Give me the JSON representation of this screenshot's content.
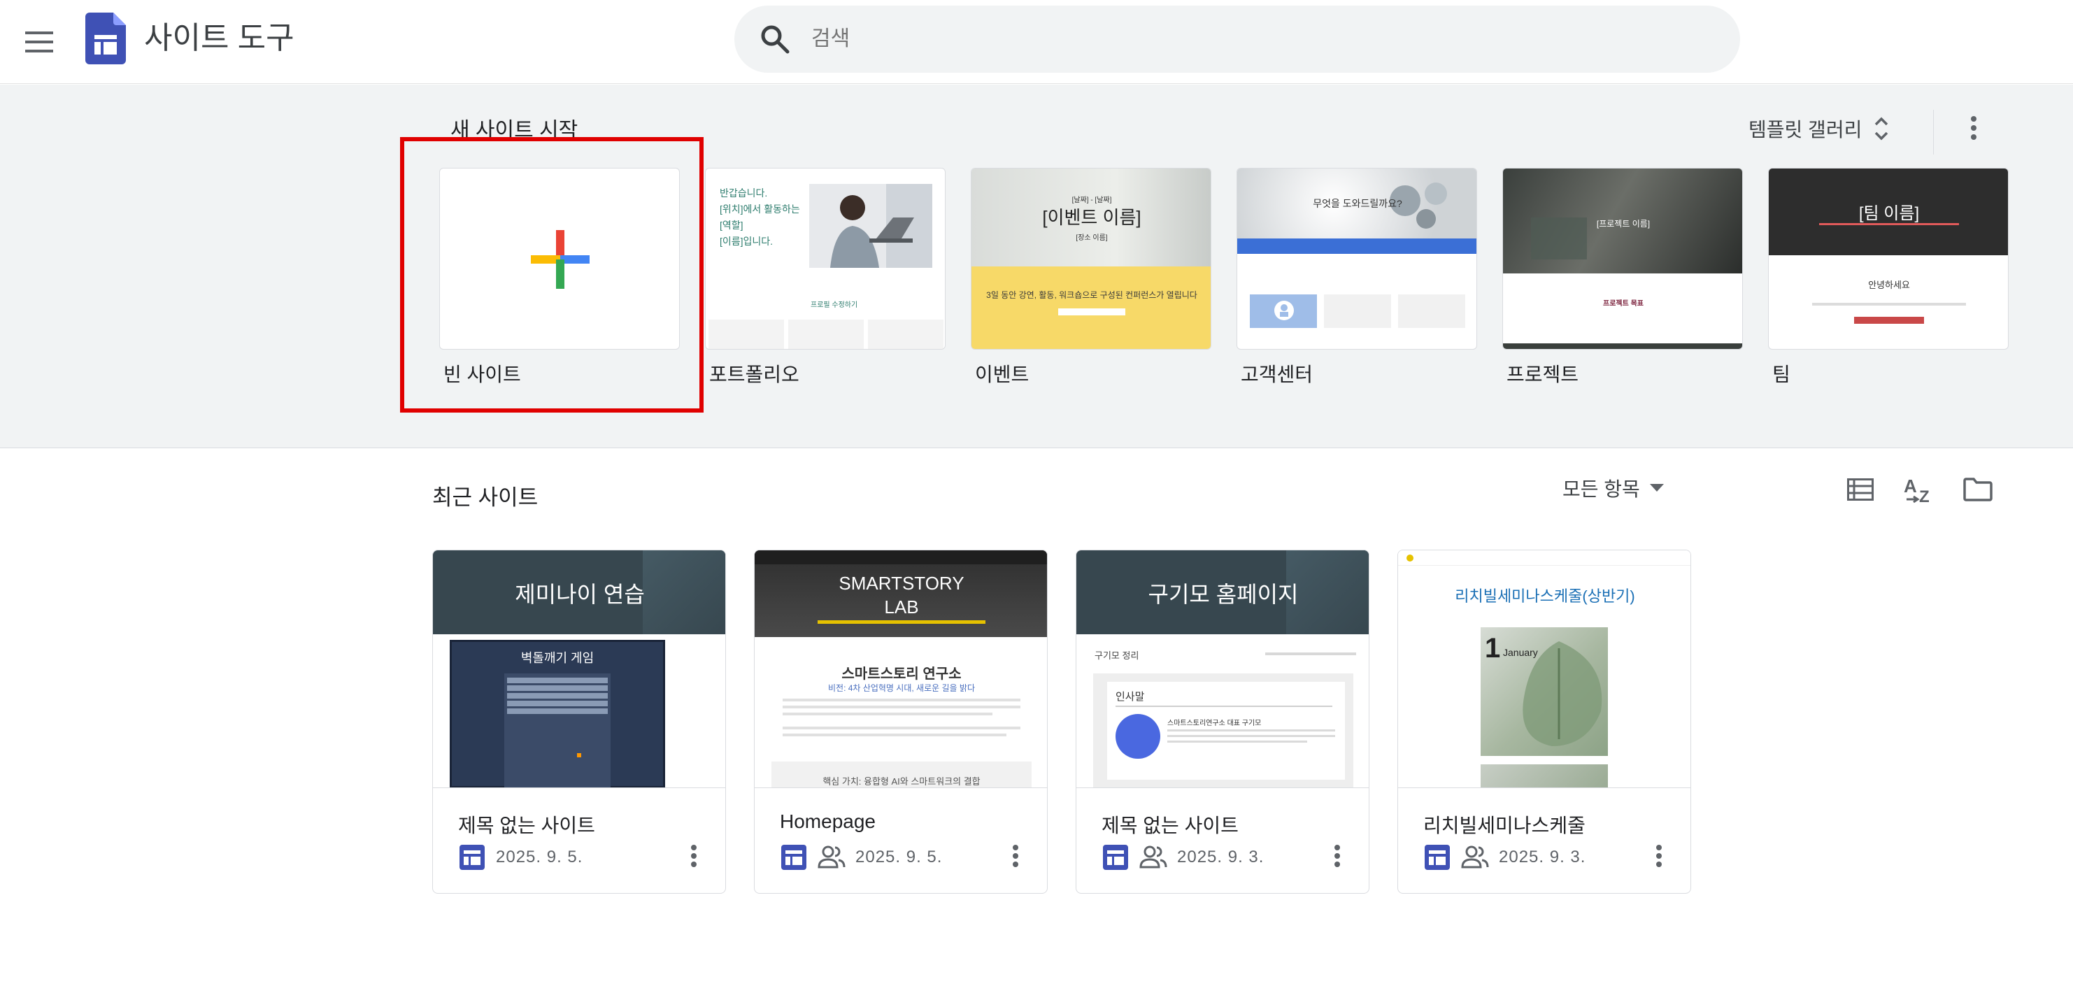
{
  "header": {
    "app_title": "사이트 도구",
    "search_placeholder": "검색"
  },
  "templates": {
    "section_title": "새 사이트 시작",
    "gallery_label": "템플릿 갤러리",
    "items": [
      {
        "name": "빈 사이트"
      },
      {
        "name": "포트폴리오",
        "thumb_lines": [
          "반갑습니다.",
          "[위치]에서 활동하는",
          "[역할]",
          "[이름]입니다."
        ],
        "thumb_caption": "프로필 수정하기"
      },
      {
        "name": "이벤트",
        "thumb_header": "[날짜] - [날짜]",
        "thumb_title": "[이벤트 이름]",
        "thumb_sub": "[장소 이름]",
        "thumb_band": "3일 동안 강연, 활동, 워크숍으로 구성된 컨퍼런스가 열립니다"
      },
      {
        "name": "고객센터",
        "thumb_title": "무엇을 도와드릴까요?"
      },
      {
        "name": "프로젝트",
        "thumb_title": "[프로젝트 이름]",
        "thumb_sub": "프로젝트 목표"
      },
      {
        "name": "팀",
        "thumb_title": "[팀 이름]",
        "thumb_sub": "안녕하세요"
      }
    ]
  },
  "recent": {
    "section_title": "최근 사이트",
    "filter_label": "모든 항목",
    "sites": [
      {
        "title": "제목 없는 사이트",
        "date": "2025. 9. 5.",
        "shared": false,
        "thumb_title": "제미나이 연습",
        "thumb_sub": "벽돌깨기 게임"
      },
      {
        "title": "Homepage",
        "date": "2025. 9. 5.",
        "shared": true,
        "thumb_title_line1": "SMARTSTORY",
        "thumb_title_line2": "LAB",
        "thumb_sub": "스마트스토리 연구소",
        "thumb_sub2": "비전: 4차 산업혁명 시대, 새로운 길을 밝다",
        "thumb_bottom": "핵심 가치: 융합형 AI와 스마트워크의 결합"
      },
      {
        "title": "제목 없는 사이트",
        "date": "2025. 9. 3.",
        "shared": true,
        "thumb_title": "구기모 홈페이지",
        "thumb_sub": "구기모 정리",
        "thumb_box_title": "인사말",
        "thumb_box_text": "스마트스토리연구소 대표 구기모"
      },
      {
        "title": "리치빌세미나스케줄",
        "date": "2025. 9. 3.",
        "shared": true,
        "thumb_title": "리치빌세미나스케줄(상반기)",
        "thumb_month_num": "1",
        "thumb_month_name": "January"
      }
    ]
  },
  "colors": {
    "site_icon": "#3f51b5",
    "selection": "#e00000",
    "plus_red": "#ea4335",
    "plus_blue": "#4285f4",
    "plus_yellow": "#fbbc04",
    "plus_green": "#34a853"
  },
  "icons": [
    "menu-icon",
    "sites-logo-icon",
    "search-icon",
    "unfold-icon",
    "more-vert-icon",
    "caret-down-icon",
    "list-view-icon",
    "sort-az-icon",
    "folder-icon",
    "site-icon",
    "people-icon"
  ]
}
